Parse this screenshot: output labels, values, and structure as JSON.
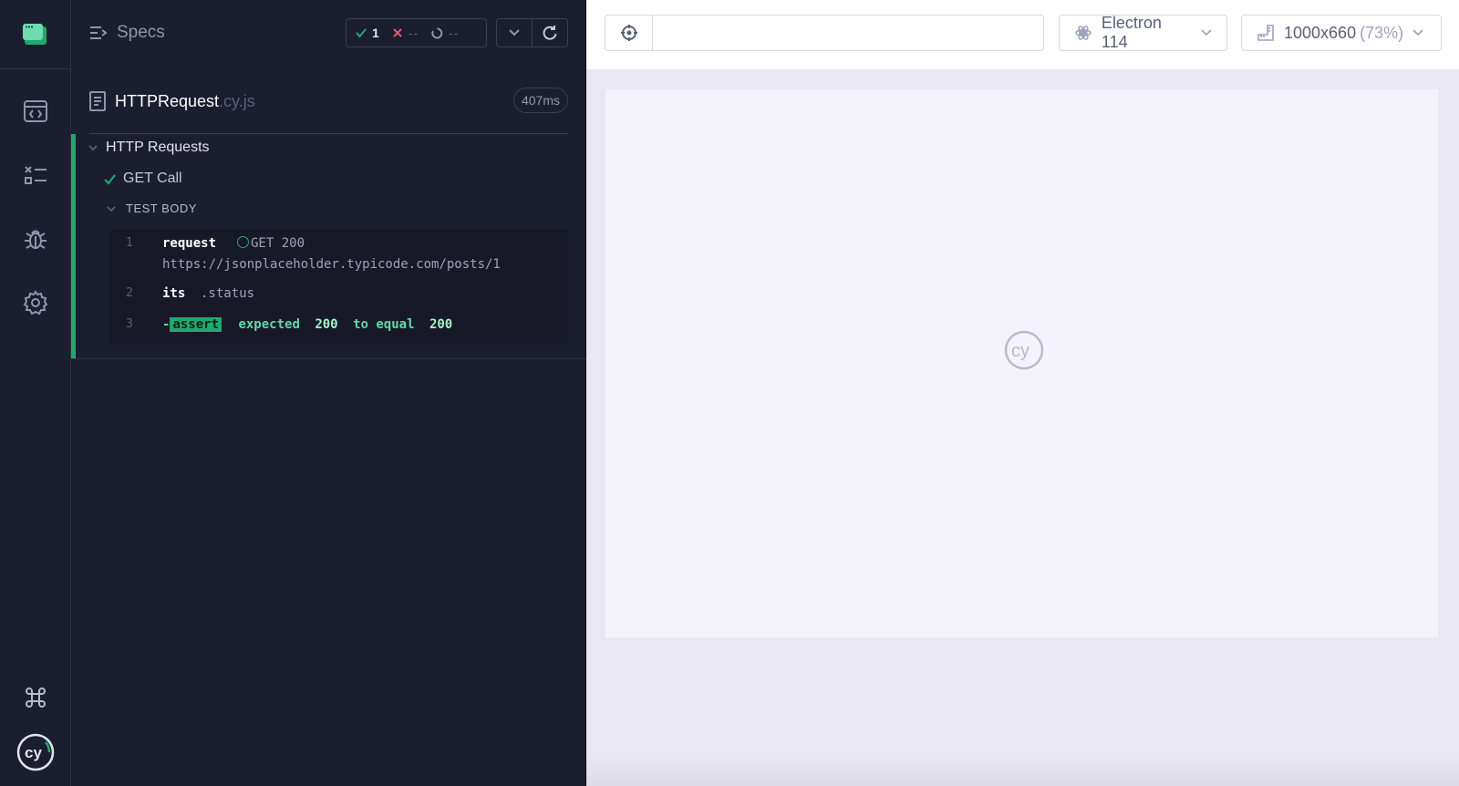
{
  "reporter": {
    "specs_label": "Specs",
    "stats": {
      "passed": "1",
      "failed": "--",
      "pending": "--"
    },
    "file": {
      "name": "HTTPRequest",
      "ext": ".cy.js",
      "duration": "407ms"
    },
    "suite_title": "HTTP Requests",
    "test_title": "GET Call",
    "body_title": "TEST BODY",
    "commands": [
      {
        "num": "1",
        "name": "request",
        "method": "GET 200",
        "url": "https://jsonplaceholder.typicode.com/posts/1"
      },
      {
        "num": "2",
        "name": "its",
        "arg": ".status"
      },
      {
        "num": "3",
        "dash": "-",
        "name": "assert",
        "text_expected": "expected",
        "val1": "200",
        "text_to_equal": "to equal",
        "val2": "200"
      }
    ]
  },
  "app": {
    "url_value": "",
    "browser": "Electron 114",
    "viewport": "1000x660",
    "viewport_scale": "(73%)"
  },
  "colors": {
    "pass": "#1fa971",
    "fail": "#e45770",
    "sidebar_bg": "#1b1e2e",
    "app_bg": "#e9e8f2"
  },
  "icons": {
    "rail": [
      "cypress-app-icon",
      "specs-icon",
      "runs-icon",
      "debug-icon",
      "settings-icon",
      "keyboard-shortcut-icon",
      "cypress-logo-icon"
    ]
  }
}
